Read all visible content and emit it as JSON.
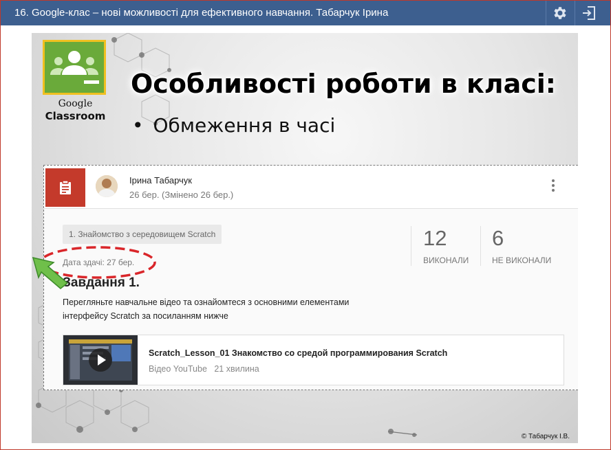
{
  "window": {
    "title": "16. Google-клас – нові можливості для ефективного навчання. Табарчук Ірина",
    "settings_icon": "gear-icon",
    "exit_icon": "exit-icon"
  },
  "slide": {
    "logo": {
      "icon": "google-classroom-logo",
      "line1": "Google",
      "line2": "Classroom"
    },
    "title": "Особливості роботи в класі:",
    "bullet": "Обмеження в часі",
    "copyright": "© Табарчук І.В."
  },
  "post": {
    "author": "Ірина Табарчук",
    "date": "26 бер. (Змінено 26 бер.)",
    "topic": "1. Знайомство з середовищем Scratch",
    "due": "Дата здачі: 27 бер.",
    "task_title": "Завдання 1.",
    "task_desc_line1": "Перегляньте навчальне відео та ознайомтеся з основними елементами",
    "task_desc_line2": "інтерфейсу Scratch за посиланням нижче",
    "stats": [
      {
        "value": "12",
        "label": "ВИКОНАЛИ"
      },
      {
        "value": "6",
        "label": "НЕ ВИКОНАЛИ"
      }
    ],
    "video": {
      "title": "Scratch_Lesson_01 Знакомство со средой программирования Scratch",
      "source": "Відео YouTube",
      "duration": "21 хвилина"
    }
  },
  "colors": {
    "topbar": "#3d5f8f",
    "assignment_tile": "#c43a2b",
    "highlight_ellipse": "#d9262a",
    "arrow": "#6fbf4a"
  }
}
